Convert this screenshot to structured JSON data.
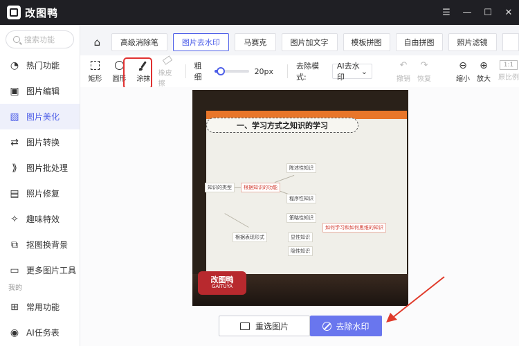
{
  "app": {
    "title": "改图鸭"
  },
  "window_controls": [
    "☰",
    "—",
    "☐",
    "✕"
  ],
  "sidebar": {
    "search_placeholder": "搜索功能",
    "items": [
      {
        "label": "热门功能",
        "icon": "fire-icon"
      },
      {
        "label": "图片编辑",
        "icon": "image-edit-icon"
      },
      {
        "label": "图片美化",
        "icon": "image-beautify-icon",
        "active": true
      },
      {
        "label": "图片转换",
        "icon": "convert-icon"
      },
      {
        "label": "图片批处理",
        "icon": "batch-icon"
      },
      {
        "label": "照片修复",
        "icon": "repair-icon"
      },
      {
        "label": "趣味特效",
        "icon": "sparkle-icon"
      },
      {
        "label": "抠图换背景",
        "icon": "cutout-icon"
      },
      {
        "label": "更多图片工具",
        "icon": "toolbox-icon"
      }
    ],
    "section_mine": "我的",
    "mine_items": [
      {
        "label": "常用功能",
        "icon": "grid-icon"
      },
      {
        "label": "AI任务表",
        "icon": "ai-icon"
      }
    ]
  },
  "tabs": [
    "高级消除笔",
    "图片去水印",
    "马赛克",
    "图片加文字",
    "模板拼图",
    "自由拼图",
    "照片滤镜"
  ],
  "active_tab": "图片去水印",
  "toolbar": {
    "rect_label": "矩形",
    "circle_label": "圆形",
    "brush_label": "涂抹",
    "eraser_label": "橡皮擦",
    "thickness_label": "粗细",
    "thickness_value": "20px",
    "thickness_level": 0.18,
    "mode_label": "去除模式:",
    "mode_value": "AI去水印",
    "undo_label": "撤销",
    "redo_label": "恢复",
    "zoom_out_label": "缩小",
    "zoom_in_label": "放大",
    "ratio_badge": "1:1",
    "original_label": "原比例"
  },
  "photo": {
    "headline": "一、学习方式之知识的学习",
    "watermark_text": "改图鸭",
    "watermark_sub": "GAITUYA",
    "nodes": [
      "知识的类型",
      "根据知识的功能",
      "根据表现形式",
      "陈述性知识",
      "程序性知识",
      "策略性知识",
      "显性知识",
      "隐性知识",
      "如何学习和如何思维的知识"
    ]
  },
  "buttons": {
    "reselect": "重选图片",
    "remove": "去除水印"
  },
  "colors": {
    "accent": "#4e5fe8",
    "remove_button": "#6976ee",
    "titlebar": "#1f1f24",
    "highlight": "#e03030"
  }
}
